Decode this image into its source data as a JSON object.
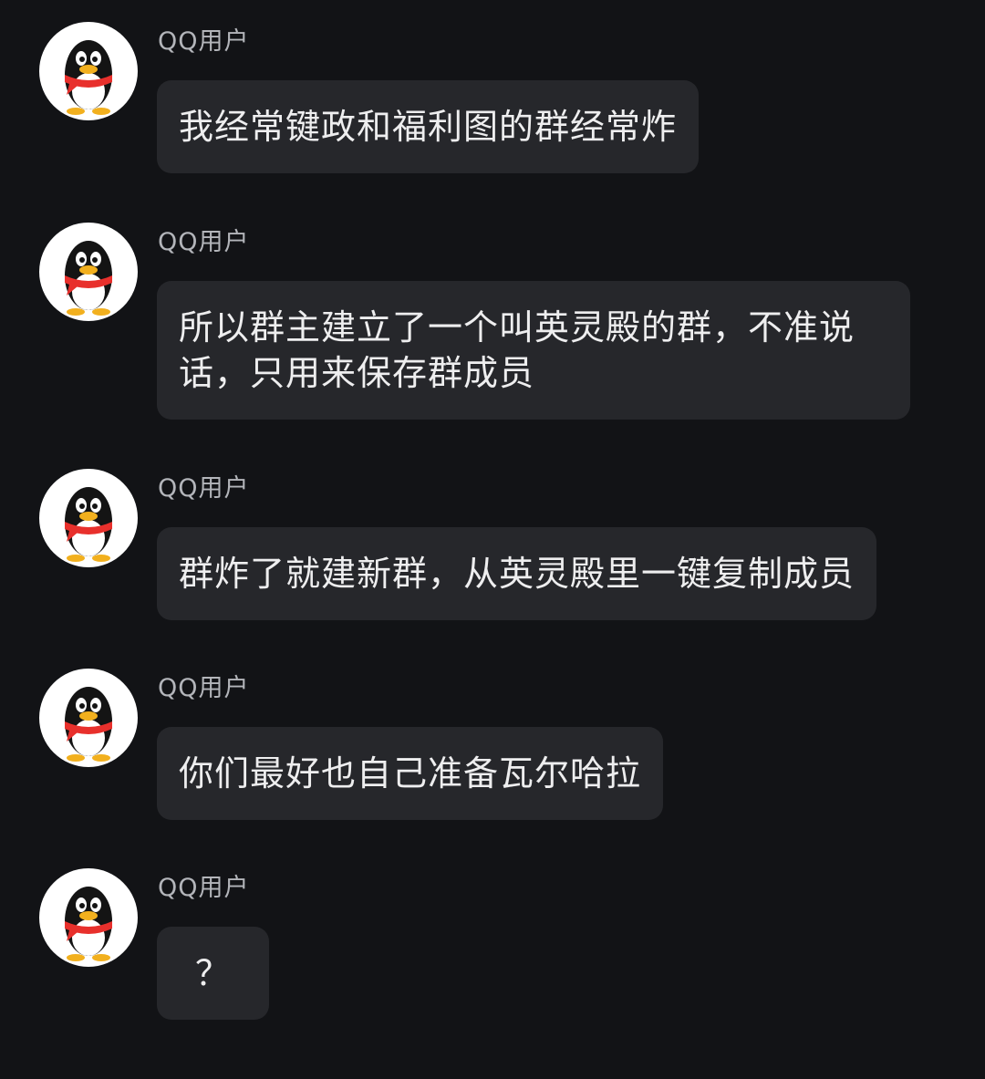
{
  "messages": [
    {
      "sender": "QQ用户",
      "text": "我经常键政和福利图的群经常炸"
    },
    {
      "sender": "QQ用户",
      "text": "所以群主建立了一个叫英灵殿的群，不准说话，只用来保存群成员"
    },
    {
      "sender": "QQ用户",
      "text": "群炸了就建新群，从英灵殿里一键复制成员"
    },
    {
      "sender": "QQ用户",
      "text": "你们最好也自己准备瓦尔哈拉"
    },
    {
      "sender": "QQ用户",
      "text": "？"
    }
  ],
  "avatar_icon": "qq-penguin-icon",
  "colors": {
    "background": "#121316",
    "bubble": "#26272b",
    "text": "#eeeeef",
    "sender": "#b3b5ba",
    "scarf": "#e8302c",
    "beak": "#f2b01e"
  }
}
